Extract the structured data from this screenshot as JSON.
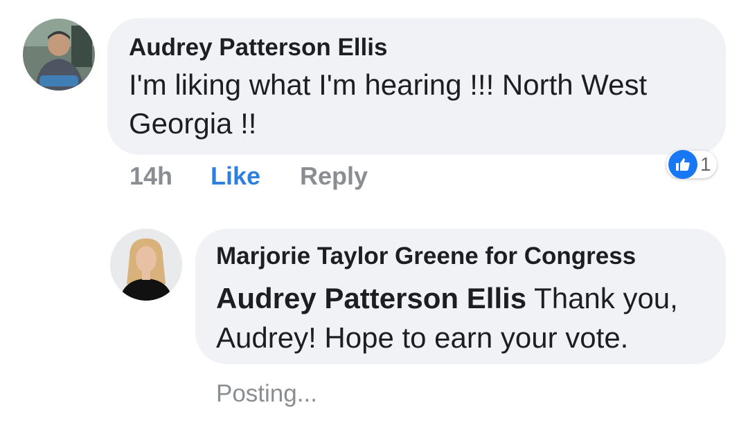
{
  "comment": {
    "author": "Audrey Patterson Ellis",
    "text": "I'm liking what I'm hearing !!!  North West Georgia  !!",
    "time": "14h",
    "like_label": "Like",
    "reply_label": "Reply",
    "reaction": {
      "icon": "thumbs-up-icon",
      "count": "1",
      "color": "#1877f2"
    }
  },
  "reply": {
    "author": "Marjorie Taylor Greene for Congress",
    "mention": "Audrey Patterson Ellis",
    "text": " Thank you, Audrey! Hope to earn your vote.",
    "status": "Posting..."
  },
  "colors": {
    "bubble": "#f0f2f5",
    "link_blue": "#2d80e0",
    "meta_gray": "#8a8d91"
  }
}
